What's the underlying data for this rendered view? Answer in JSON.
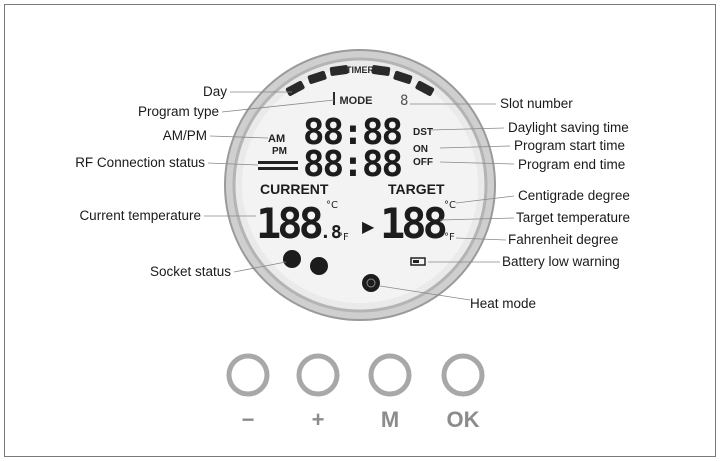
{
  "callouts_left": [
    {
      "id": "day",
      "text": "Day"
    },
    {
      "id": "program-type",
      "text": "Program type"
    },
    {
      "id": "am-pm",
      "text": "AM/PM"
    },
    {
      "id": "rf-connection",
      "text": "RF Connection status"
    },
    {
      "id": "current-temp",
      "text": "Current temperature"
    },
    {
      "id": "socket-status",
      "text": "Socket status"
    }
  ],
  "callouts_right": [
    {
      "id": "slot-number",
      "text": "Slot number"
    },
    {
      "id": "dst",
      "text": "Daylight saving time"
    },
    {
      "id": "program-start",
      "text": "Program start time"
    },
    {
      "id": "program-end",
      "text": "Program end time"
    },
    {
      "id": "centigrade",
      "text": "Centigrade degree"
    },
    {
      "id": "target-temp",
      "text": "Target temperature"
    },
    {
      "id": "fahrenheit",
      "text": "Fahrenheit degree"
    },
    {
      "id": "battery-low",
      "text": "Battery low warning"
    },
    {
      "id": "heat-mode",
      "text": "Heat mode"
    }
  ],
  "lcd": {
    "timer_label": "TIMER",
    "mode_label": "MODE",
    "slot_digit": "8",
    "am": "AM",
    "pm": "PM",
    "time_top": "88:88",
    "time_bottom": "88:88",
    "dst": "DST",
    "on": "ON",
    "off": "OFF",
    "current_label": "CURRENT",
    "target_label": "TARGET",
    "current_value": "188",
    "current_decimal": ".8",
    "target_value": "188",
    "deg_c": "°C",
    "deg_f": "°F",
    "arrow": "▶"
  },
  "buttons": [
    {
      "id": "minus",
      "label": "−"
    },
    {
      "id": "plus",
      "label": "+"
    },
    {
      "id": "m",
      "label": "M"
    },
    {
      "id": "ok",
      "label": "OK"
    }
  ]
}
